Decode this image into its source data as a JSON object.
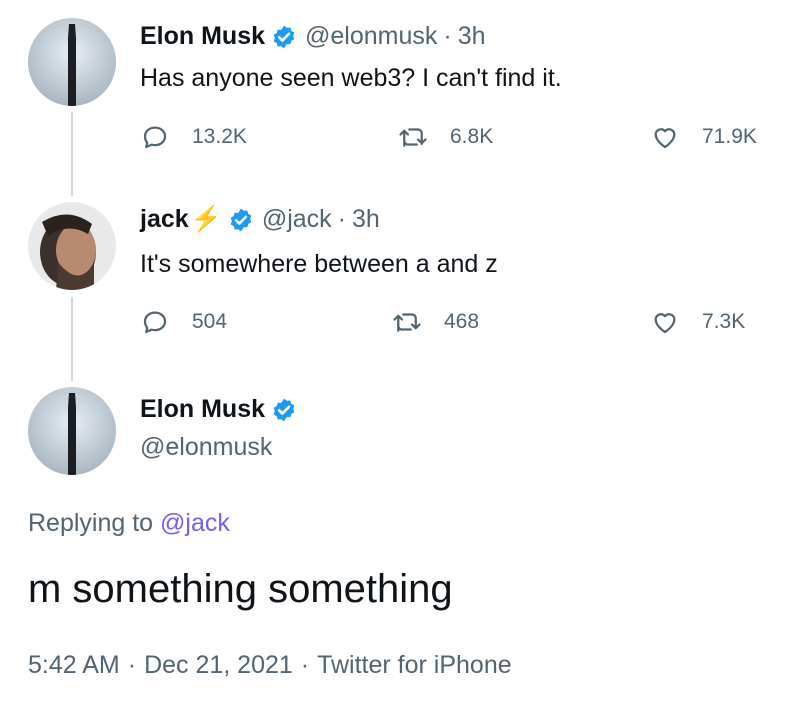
{
  "thread": [
    {
      "name": "Elon Musk",
      "handle": "@elonmusk",
      "sep": "·",
      "time": "3h",
      "text": "Has anyone seen web3? I can't find it.",
      "replies": "13.2K",
      "retweets": "6.8K",
      "likes": "71.9K"
    },
    {
      "name": "jack",
      "emoji": "⚡",
      "handle": "@jack",
      "sep": "·",
      "time": "3h",
      "text": "It's somewhere between a and z",
      "replies": "504",
      "retweets": "468",
      "likes": "7.3K"
    }
  ],
  "main": {
    "name": "Elon Musk",
    "handle": "@elonmusk",
    "replying_prefix": "Replying to",
    "replying_to": "@jack",
    "text": "m something something",
    "time": "5:42 AM",
    "sep1": "·",
    "date": "Dec 21, 2021",
    "sep2": "·",
    "source": "Twitter for iPhone"
  },
  "colors": {
    "verified": "#1d9bf0",
    "mention": "#7a5cf0",
    "secondary": "#536471",
    "bolt": "#f7b924"
  },
  "icons": {
    "reply": "reply-icon",
    "retweet": "retweet-icon",
    "like": "heart-icon",
    "verified": "verified-badge-icon"
  }
}
